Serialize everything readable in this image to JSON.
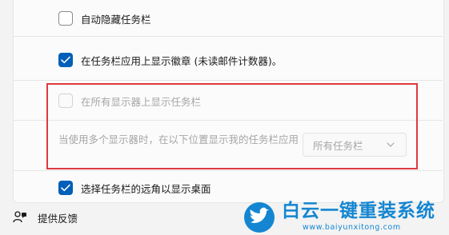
{
  "settings": {
    "auto_hide": {
      "label": "自动隐藏任务栏",
      "checked": false
    },
    "show_badges": {
      "label": "在任务栏应用上显示徽章 (未读邮件计数器)。",
      "checked": true
    },
    "all_displays": {
      "label": "在所有显示器上显示任务栏",
      "checked": false,
      "disabled": true
    },
    "multi_display_desc": "当使用多个显示器时，在以下位置显示我的任务栏应用",
    "multi_display_dropdown": {
      "value": "所有任务栏",
      "disabled": true
    },
    "corner_desktop": {
      "label": "选择任务栏的远角以显示桌面",
      "checked": true
    }
  },
  "footer": {
    "feedback_label": "提供反馈"
  },
  "watermark": {
    "brand": "白云一键重装系统",
    "url": "www.baiyunxitong.com"
  },
  "colors": {
    "accent": "#005fb8",
    "highlight": "#e0393e",
    "watermark": "#1486d1"
  }
}
